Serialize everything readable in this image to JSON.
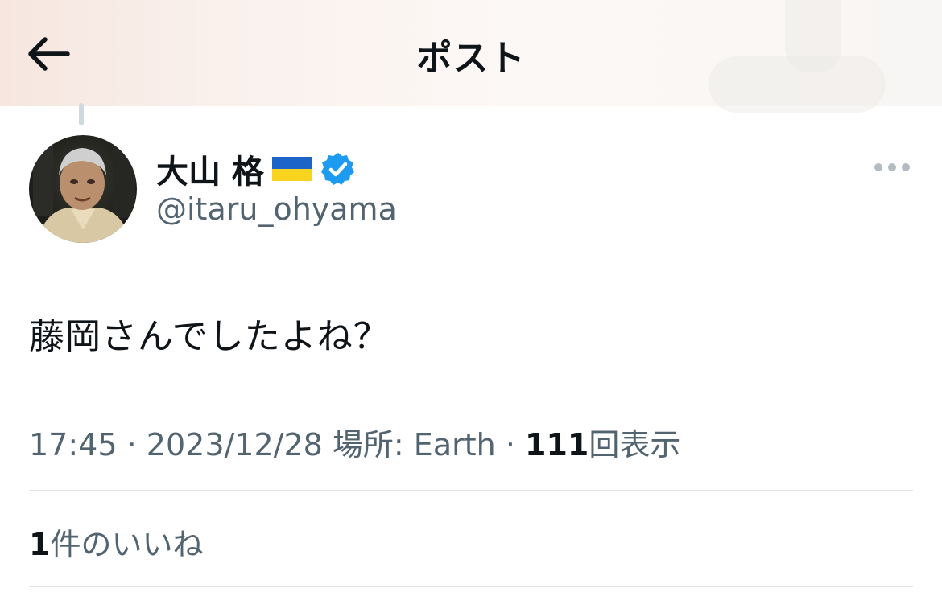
{
  "header": {
    "title": "ポスト",
    "back_icon": "arrow-left-icon"
  },
  "author": {
    "display_name": "大山 格",
    "flag_icon": "ukraine-flag-icon",
    "verified_icon": "verified-badge-icon",
    "handle": "@itaru_ohyama"
  },
  "more_icon": "more-horizontal-icon",
  "tweet": {
    "text": "藤岡さんでしたよね？"
  },
  "meta": {
    "time": "17:45",
    "separator": "·",
    "date": "2023/12/28",
    "location": "場所: Earth",
    "views_count": "111",
    "views_label": "回表示"
  },
  "likes": {
    "count": "1",
    "label": "件のいいね"
  },
  "colors": {
    "text": "#0f1419",
    "secondary": "#536471",
    "verified": "#1d9bf0",
    "divider": "#e1e6ea"
  }
}
